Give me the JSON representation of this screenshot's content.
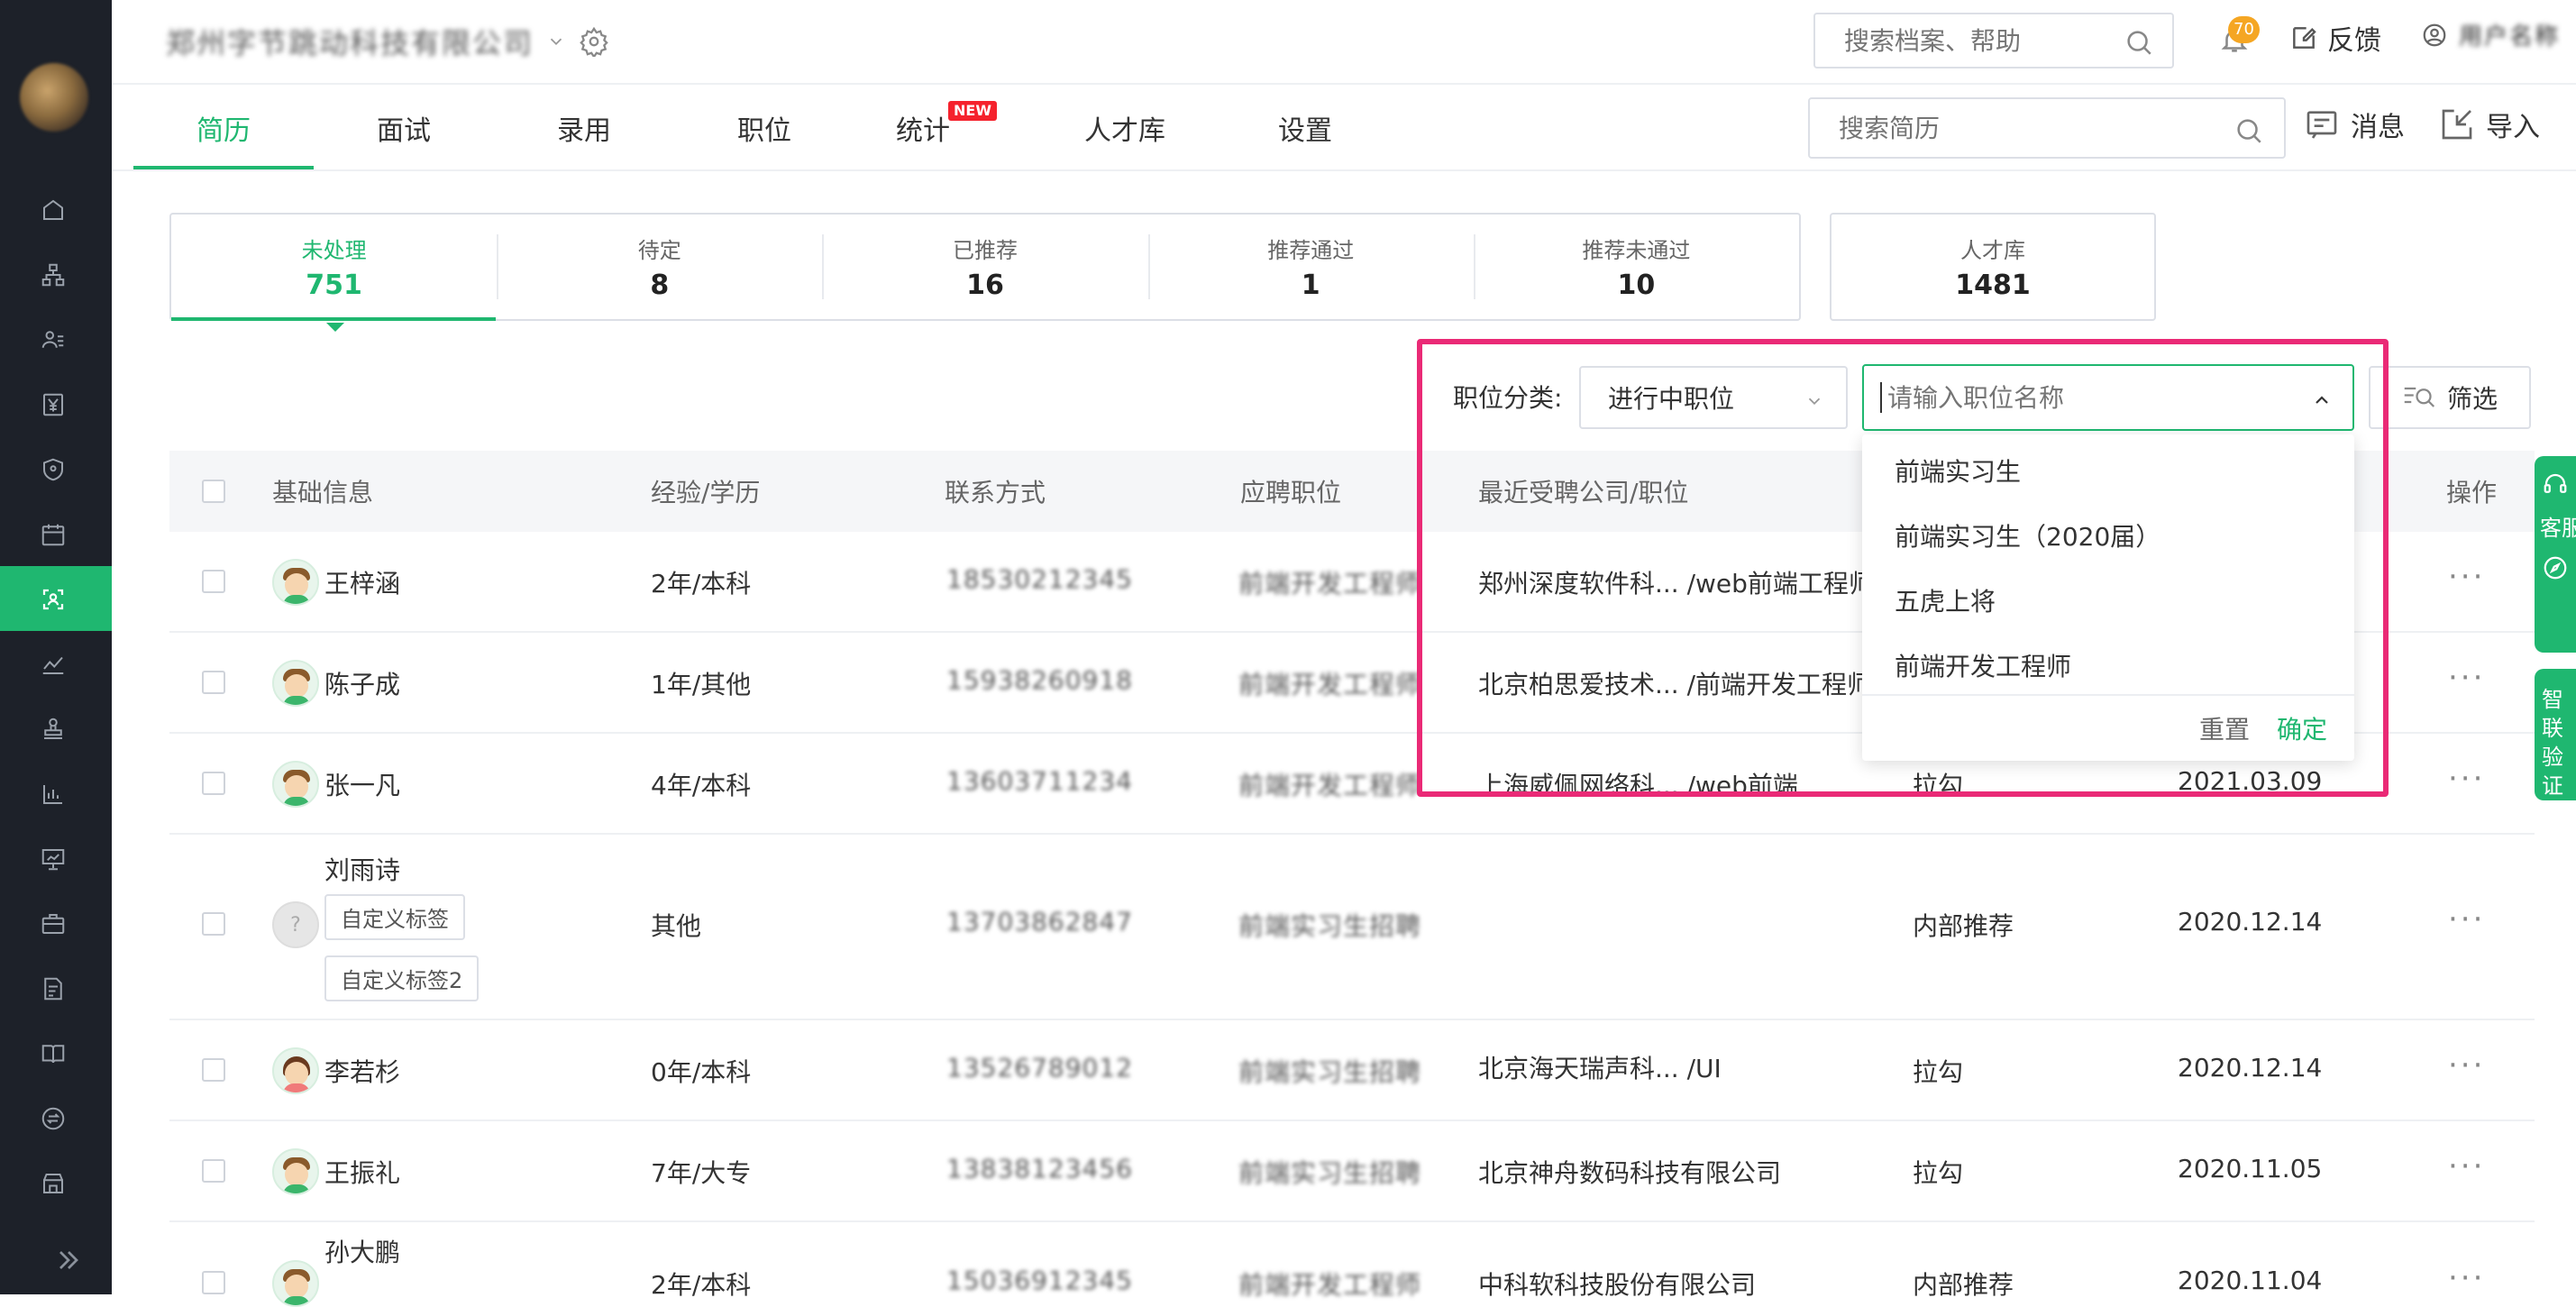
{
  "header": {
    "company_name": "郑州字节跳动科技有限公司",
    "search_placeholder": "搜索档案、帮助",
    "notification_count": "70",
    "feedback_label": "反馈",
    "user_name": "用户名称"
  },
  "tabs": [
    {
      "label": "简历"
    },
    {
      "label": "面试"
    },
    {
      "label": "录用"
    },
    {
      "label": "职位"
    },
    {
      "label": "统计"
    },
    {
      "label": "人才库"
    },
    {
      "label": "设置"
    }
  ],
  "new_badge": "NEW",
  "resume_search_placeholder": "搜索简历",
  "messages_label": "消息",
  "import_label": "导入",
  "stats": [
    {
      "label": "未处理",
      "value": "751"
    },
    {
      "label": "待定",
      "value": "8"
    },
    {
      "label": "已推荐",
      "value": "16"
    },
    {
      "label": "推荐通过",
      "value": "1"
    },
    {
      "label": "推荐未通过",
      "value": "10"
    }
  ],
  "talent_pool": {
    "label": "人才库",
    "value": "1481"
  },
  "filter": {
    "label": "职位分类:",
    "select_value": "进行中职位",
    "job_input_placeholder": "请输入职位名称",
    "filter_button": "筛选",
    "options": [
      "前端实习生",
      "前端实习生（2020届）",
      "五虎上将",
      "前端开发工程师"
    ],
    "reset": "重置",
    "confirm": "确定"
  },
  "table": {
    "columns": {
      "basic": "基础信息",
      "exp": "经验/学历",
      "contact": "联系方式",
      "position": "应聘职位",
      "recent": "最近受聘公司/职位",
      "actions": "操作"
    },
    "rows": [
      {
        "name": "王梓涵",
        "exp": "2年/本科",
        "phone": "18530212345",
        "position": "前端开发工程师",
        "recent": "郑州深度软件科... /web前端工程师",
        "source": "",
        "date": "",
        "more": "···"
      },
      {
        "name": "陈子成",
        "exp": "1年/其他",
        "phone": "15938260918",
        "position": "前端开发工程师",
        "recent": "北京柏思爱技术... /前端开发工程师",
        "source": "",
        "date": "",
        "more": "···"
      },
      {
        "name": "张一凡",
        "exp": "4年/本科",
        "phone": "13603711234",
        "position": "前端开发工程师",
        "recent": "上海威佩网络科... /web前端",
        "source": "拉勾",
        "date": "2021.03.09",
        "more": "···"
      },
      {
        "name": "刘雨诗",
        "exp": "其他",
        "phone": "13703862847",
        "position": "前端实习生招聘",
        "recent": "",
        "source": "内部推荐",
        "date": "2020.12.14",
        "more": "···",
        "tags": [
          "自定义标签",
          "自定义标签2"
        ]
      },
      {
        "name": "李若杉",
        "exp": "0年/本科",
        "phone": "13526789012",
        "position": "前端实习生招聘",
        "recent": "北京海天瑞声科... /UI",
        "source": "拉勾",
        "date": "2020.12.14",
        "more": "···"
      },
      {
        "name": "王振礼",
        "exp": "7年/大专",
        "phone": "13838123456",
        "position": "前端实习生招聘",
        "recent": "北京神舟数码科技有限公司",
        "source": "拉勾",
        "date": "2020.11.05",
        "more": "···"
      },
      {
        "name": "孙大鹏",
        "exp": "2年/本科",
        "phone": "15036912345",
        "position": "前端开发工程师",
        "recent": "中科软科技股份有限公司",
        "source": "内部推荐",
        "date": "2020.11.04",
        "more": "···"
      }
    ]
  },
  "float_widgets": {
    "service": "客服",
    "smart_verify": "智联验证"
  },
  "colors": {
    "brand": "#1fb770",
    "sidebar": "#1d2129",
    "highlight": "#ea2a76",
    "badge": "#f5a623",
    "new_badge": "#f5222d"
  },
  "icons": {
    "sidebar": [
      "home-icon",
      "org-icon",
      "users-icon",
      "yen-icon",
      "shield-icon",
      "calendar-icon",
      "resume-scan-icon",
      "line-chart-icon",
      "stamp-icon",
      "bar-chart-icon",
      "presentation-icon",
      "briefcase-icon",
      "report-icon",
      "book-icon",
      "exchange-icon",
      "store-icon"
    ]
  }
}
